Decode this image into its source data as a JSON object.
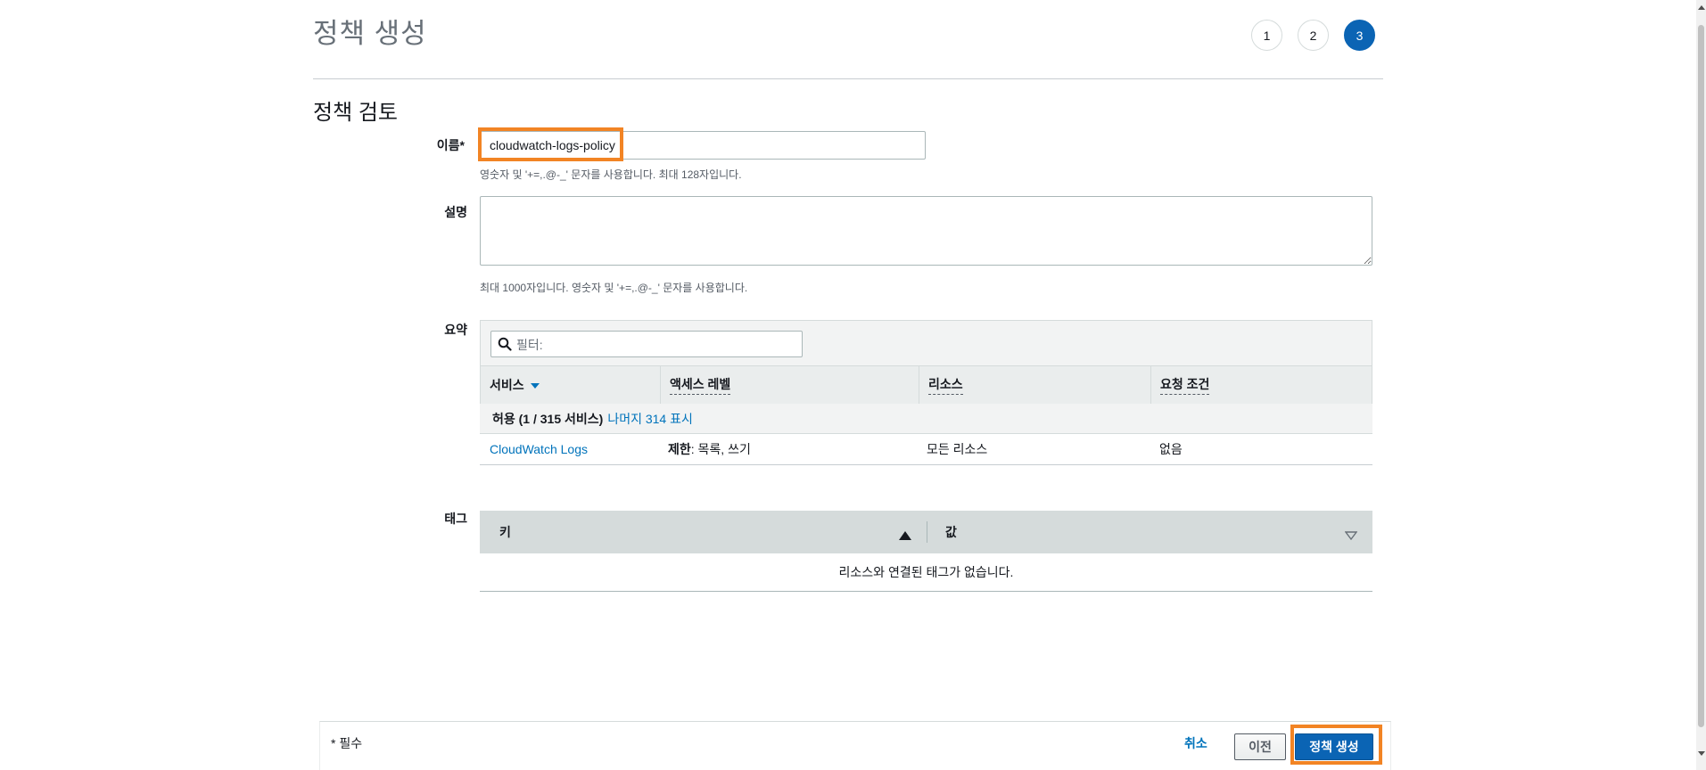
{
  "header": {
    "title": "정책 생성",
    "steps": [
      "1",
      "2",
      "3"
    ],
    "active_step": "3"
  },
  "review": {
    "section_title": "정책 검토",
    "name": {
      "label": "이름*",
      "value": "cloudwatch-logs-policy",
      "hint": "영숫자 및 '+=,.@-_' 문자를 사용합니다. 최대 128자입니다."
    },
    "description": {
      "label": "설명",
      "value": "",
      "hint": "최대 1000자입니다. 영숫자 및 '+=,.@-_' 문자를 사용합니다."
    },
    "summary": {
      "label": "요약",
      "filter_placeholder": "필터:",
      "columns": {
        "service": "서비스",
        "access_level": "액세스 레벨",
        "resource": "리소스",
        "request_condition": "요청 조건"
      },
      "group": {
        "label": "허용 (1 / 315 서비스)",
        "show_more": "나머지 314 표시"
      },
      "rows": [
        {
          "service": "CloudWatch Logs",
          "access_prefix": "제한",
          "access_rest": ": 목록, 쓰기",
          "resource": "모든 리소스",
          "condition": "없음"
        }
      ]
    },
    "tags": {
      "label": "태그",
      "key_header": "키",
      "value_header": "값",
      "empty_text": "리소스와 연결된 태그가 없습니다."
    }
  },
  "footer": {
    "required_note": "* 필수",
    "cancel": "취소",
    "previous": "이전",
    "create": "정책 생성"
  },
  "colors": {
    "primary": "#0b64b4",
    "link": "#0073bb",
    "highlight": "#f28424"
  }
}
